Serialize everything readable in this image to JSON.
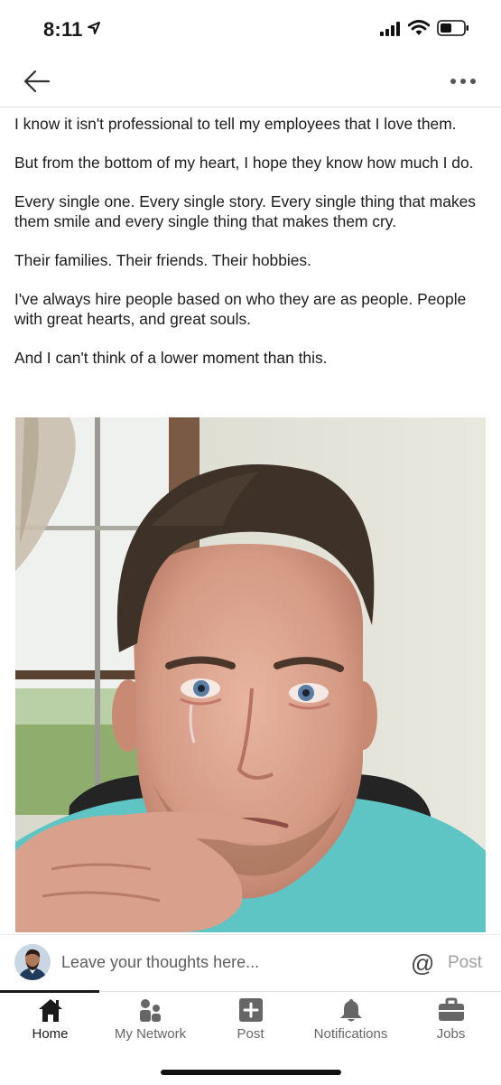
{
  "status_bar": {
    "time": "8:11"
  },
  "post": {
    "paragraphs": [
      "I know it isn't professional to tell my employees that I love them.",
      "But from the bottom of my heart, I hope they know how much I do.",
      "Every single one. Every single story. Every single thing that makes them smile and every single thing that makes them cry.",
      "Their families. Their friends. Their hobbies.",
      "I've always hire people based on who they are as people. People with great hearts, and great souls.",
      "And I can't think of a lower moment than this."
    ]
  },
  "comment_bar": {
    "placeholder": "Leave your thoughts here...",
    "mention_symbol": "@",
    "post_label": "Post"
  },
  "tabs": [
    {
      "label": "Home",
      "icon": "home-icon",
      "active": true
    },
    {
      "label": "My Network",
      "icon": "network-icon",
      "active": false
    },
    {
      "label": "Post",
      "icon": "plus-icon",
      "active": false
    },
    {
      "label": "Notifications",
      "icon": "bell-icon",
      "active": false
    },
    {
      "label": "Jobs",
      "icon": "briefcase-icon",
      "active": false
    }
  ],
  "colors": {
    "text": "#1b1b1b",
    "muted": "#666666",
    "post_disabled": "#a0a0a0",
    "shirt": "#5ec4c4"
  }
}
